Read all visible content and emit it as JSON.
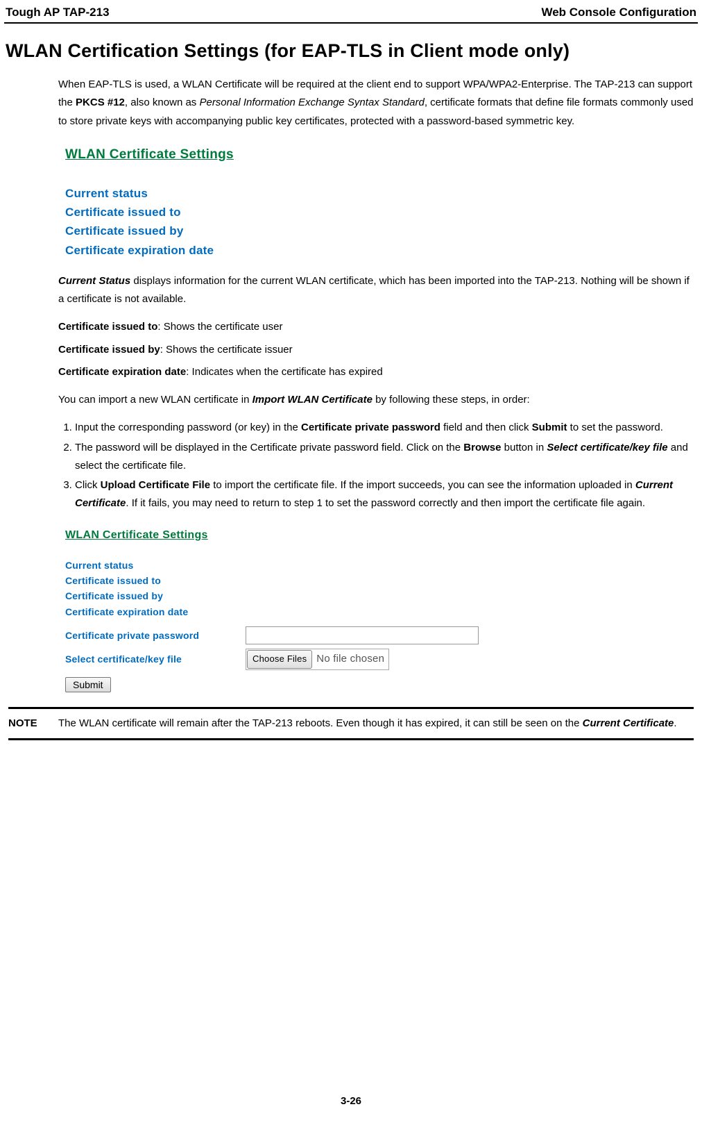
{
  "header": {
    "left": "Tough AP TAP-213",
    "right": "Web Console Configuration"
  },
  "title": "WLAN Certification Settings (for EAP-TLS in Client mode only)",
  "intro": {
    "p1a": "When EAP-TLS is used, a WLAN Certificate will be required at the client end to support WPA/WPA2-Enterprise. The TAP-213 can support the ",
    "pkcs": "PKCS #12",
    "p1b": ", also known as ",
    "pies": "Personal Information Exchange Syntax Standard",
    "p1c": ", certificate formats that define file formats commonly used to store private keys with accompanying public key certificates, protected with a password-based symmetric key."
  },
  "sc1": {
    "title": "WLAN Certificate Settings",
    "rows": [
      "Current status",
      "Certificate issued to",
      "Certificate issued by",
      "Certificate expiration date"
    ]
  },
  "desc": {
    "cs_a": "Current Status",
    "cs_b": " displays information for the current WLAN certificate, which has been imported into the TAP-213. Nothing will be shown if a certificate is not available.",
    "cit_a": "Certificate issued to",
    "cit_b": ": Shows the certificate user",
    "cib_a": "Certificate issued by",
    "cib_b": ": Shows the certificate issuer",
    "ced_a": "Certificate expiration date",
    "ced_b": ": Indicates when the certificate has expired",
    "imp_a": "You can import a new WLAN certificate in ",
    "imp_b": "Import WLAN Certificate",
    "imp_c": " by following these steps, in order:"
  },
  "steps": {
    "s1a": "Input the corresponding password (or key) in the ",
    "s1b": "Certificate private password",
    "s1c": " field and then click ",
    "s1d": "Submit",
    "s1e": " to set the password.",
    "s2a": "The password will be displayed in the Certificate private password field. Click on the ",
    "s2b": "Browse",
    "s2c": " button in ",
    "s2d": "Select certificate/key file",
    "s2e": " and select the certificate file.",
    "s3a": "Click ",
    "s3b": "Upload Certificate File",
    "s3c": " to import the certificate file. If the import succeeds, you can see the information uploaded in ",
    "s3d": "Current Certificate",
    "s3e": ". If it fails, you may need to return to step 1 to set the password correctly and then import the certificate file again."
  },
  "sc2": {
    "title": "WLAN Certificate Settings",
    "rows": [
      "Current status",
      "Certificate issued to",
      "Certificate issued by",
      "Certificate expiration date"
    ],
    "pw_label": "Certificate private password",
    "file_label": "Select certificate/key file",
    "choose": "Choose Files",
    "nofile": "No file chosen",
    "submit": "Submit"
  },
  "note": {
    "label": "NOTE",
    "a": "The WLAN certificate will remain after the TAP-213 reboots. Even though it has expired, it can still be seen on the ",
    "b": "Current Certificate",
    "c": "."
  },
  "page_number": "3-26"
}
